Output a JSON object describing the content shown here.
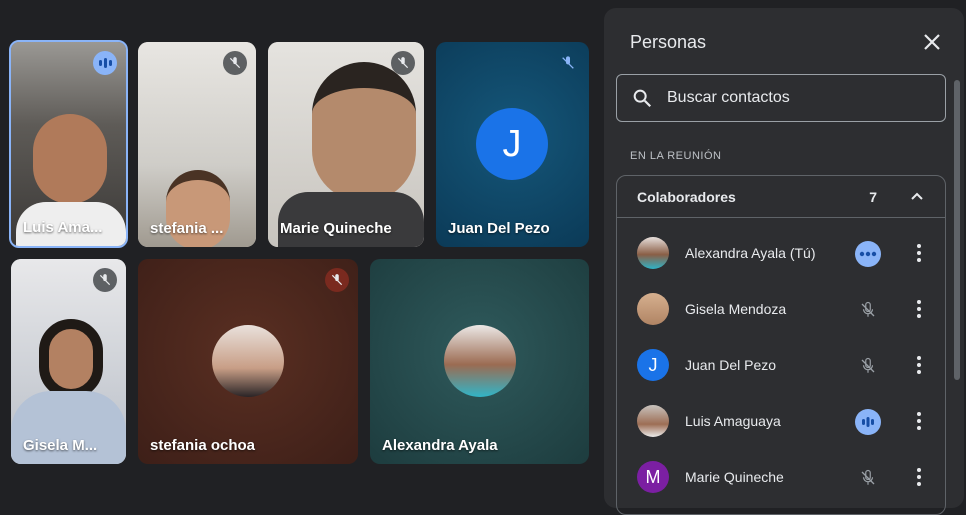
{
  "tiles": [
    {
      "name": "Luis Ama...",
      "status": "speaking"
    },
    {
      "name": "stefania ...",
      "status": "muted"
    },
    {
      "name": "Marie Quineche",
      "status": "muted"
    },
    {
      "name": "Juan Del Pezo",
      "status": "muted",
      "initial": "J"
    },
    {
      "name": "Gisela M...",
      "status": "muted"
    },
    {
      "name": "stefania ochoa",
      "status": "muted"
    },
    {
      "name": "Alexandra Ayala",
      "status": "none"
    }
  ],
  "panel": {
    "title": "Personas",
    "search_placeholder": "Buscar contactos",
    "section_label": "EN LA REUNIÓN",
    "group_title": "Colaboradores",
    "group_count": "7",
    "people": [
      {
        "name": "Alexandra Ayala (Tú)",
        "status": "more"
      },
      {
        "name": "Gisela Mendoza",
        "status": "muted"
      },
      {
        "name": "Juan Del Pezo",
        "status": "muted",
        "initial": "J"
      },
      {
        "name": "Luis Amaguaya",
        "status": "speaking"
      },
      {
        "name": "Marie Quineche",
        "status": "muted",
        "initial": "M"
      }
    ]
  },
  "colors": {
    "background": "#202124",
    "panel": "#2d2e31",
    "accent": "#8ab4f8",
    "juan_avatar": "#1a73e8",
    "marie_avatar": "#7b1fa2"
  }
}
